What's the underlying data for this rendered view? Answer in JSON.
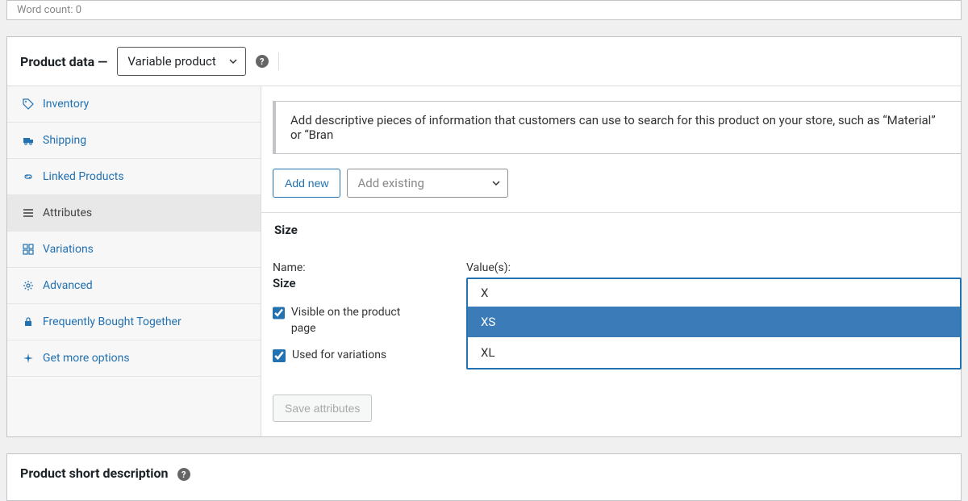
{
  "wordcount_label": "Word count: 0",
  "panel_title": "Product data —",
  "product_type": "Variable product",
  "help": "?",
  "tabs": {
    "inventory": "Inventory",
    "shipping": "Shipping",
    "linked": "Linked Products",
    "attributes": "Attributes",
    "variations": "Variations",
    "advanced": "Advanced",
    "fbt": "Frequently Bought Together",
    "getmore": "Get more options"
  },
  "notice": "Add descriptive pieces of information that customers can use to search for this product on your store, such as “Material” or “Bran",
  "add_new": "Add new",
  "add_existing_placeholder": "Add existing",
  "attr_section_title": "Size",
  "name_label": "Name:",
  "name_value": "Size",
  "visible_label": "Visible on the product page",
  "used_label": "Used for variations",
  "values_label": "Value(s):",
  "search_value": "X",
  "options": [
    {
      "label": "XS",
      "selected": true
    },
    {
      "label": "XL",
      "selected": false
    }
  ],
  "save_label": "Save attributes",
  "short_desc_title": "Product short description"
}
